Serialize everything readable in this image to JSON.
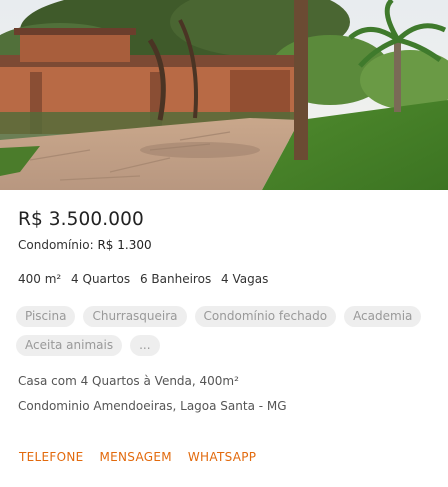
{
  "listing": {
    "price": "R$ 3.500.000",
    "condo_label": "Condomínio:",
    "condo_value": "R$ 1.300",
    "features": [
      "400 m²",
      "4 Quartos",
      "6 Banheiros",
      "4 Vagas"
    ],
    "tags": [
      "Piscina",
      "Churrasqueira",
      "Condomínio fechado",
      "Academia",
      "Aceita animais",
      "..."
    ],
    "description": "Casa com 4 Quartos à Venda, 400m²",
    "address": "Condominio Amendoeiras, Lagoa Santa - MG"
  },
  "actions": {
    "phone_label": "TELEFONE",
    "message_label": "MENSAGEM",
    "whatsapp_label": "WHATSAPP"
  },
  "colors": {
    "accent": "#e26a0d",
    "tag_bg": "#eeeeee",
    "tag_text": "#999999"
  }
}
